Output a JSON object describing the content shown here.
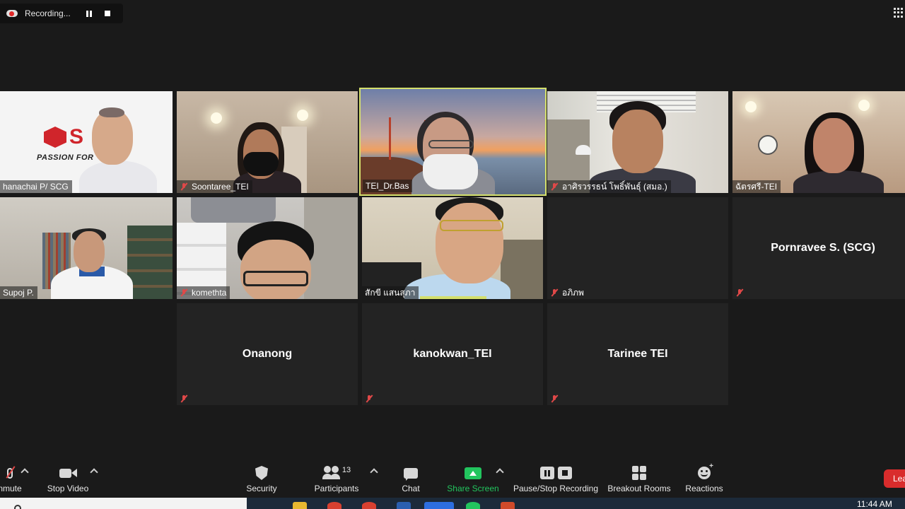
{
  "recording": {
    "label": "Recording..."
  },
  "tiles": [
    {
      "name": "hanachai P/ SCG",
      "muted": false,
      "video": true,
      "logo_text": "PASSION FOR",
      "logo_letter": "S"
    },
    {
      "name": "Soontaree_TEI",
      "muted": true,
      "video": true
    },
    {
      "name": "TEI_Dr.Bas",
      "muted": false,
      "video": true,
      "active": true
    },
    {
      "name": "อาศิรวรรธน์ โพธิ์พันธุ์ (สมอ.)",
      "muted": true,
      "video": true
    },
    {
      "name": "ฉัตรศรี-TEI",
      "muted": false,
      "video": true
    },
    {
      "name": "Supoj P.",
      "muted": false,
      "video": true
    },
    {
      "name": "komethta",
      "muted": true,
      "video": true
    },
    {
      "name": "สักขี แสนสุภา",
      "muted": false,
      "video": true,
      "speaking": true
    },
    {
      "name": "อภิภพ",
      "muted": true,
      "video": false
    },
    {
      "name": "Pornravee S. (SCG)",
      "muted": true,
      "video": false
    },
    {
      "name": "Onanong",
      "muted": true,
      "video": false
    },
    {
      "name": "kanokwan_TEI",
      "muted": true,
      "video": false
    },
    {
      "name": "Tarinee TEI",
      "muted": true,
      "video": false
    }
  ],
  "toolbar": {
    "unmute": "nmute",
    "stop_video": "Stop Video",
    "security": "Security",
    "participants": "Participants",
    "participants_count": "13",
    "chat": "Chat",
    "share_screen": "Share Screen",
    "pause_stop_recording": "Pause/Stop Recording",
    "breakout_rooms": "Breakout Rooms",
    "reactions": "Reactions",
    "leave": "Lea"
  },
  "taskbar": {
    "time": "11:44 AM"
  },
  "colors": {
    "active_border": "#d4df6c",
    "share_green": "#22c55e",
    "leave_red": "#d92c2c",
    "muted_red": "#e04848"
  }
}
